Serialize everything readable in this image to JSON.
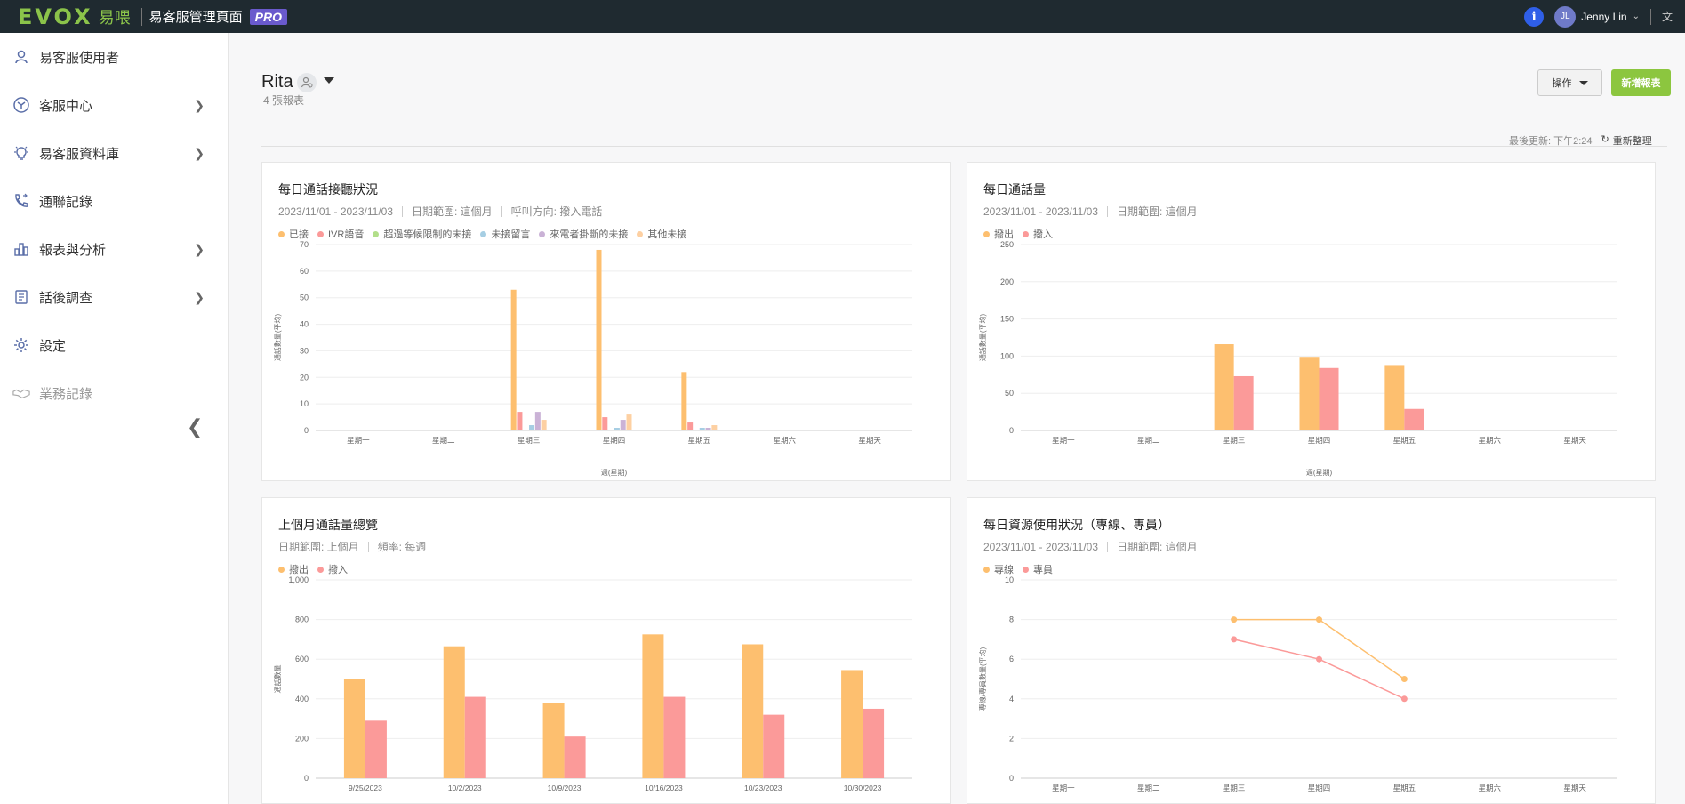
{
  "topbar": {
    "logo_main": "EVOX",
    "logo_sub": "易喂",
    "title": "易客服管理頁面",
    "pro_badge": "PRO",
    "info_icon": "info-icon",
    "user_initials": "JL",
    "user_name": "Jenny Lin",
    "lang_glyph": "文"
  },
  "sidebar": {
    "items": [
      {
        "label": "易客服使用者",
        "icon": "user-icon",
        "arrow": false
      },
      {
        "label": "客服中心",
        "icon": "hub-icon",
        "arrow": true
      },
      {
        "label": "易客服資料庫",
        "icon": "lightbulb-icon",
        "arrow": true
      },
      {
        "label": "通聯記錄",
        "icon": "phone-log-icon",
        "arrow": false
      },
      {
        "label": "報表與分析",
        "icon": "bar-chart-icon",
        "arrow": true
      },
      {
        "label": "話後調查",
        "icon": "survey-icon",
        "arrow": true
      },
      {
        "label": "設定",
        "icon": "gear-icon",
        "arrow": false
      },
      {
        "label": "業務記錄",
        "icon": "handshake-icon",
        "arrow": false,
        "disabled": true
      }
    ]
  },
  "header": {
    "title": "Rita",
    "subtitle": "4 張報表",
    "op_button": "操作",
    "new_button": "新增報表",
    "last_update": "最後更新: 下午2:24",
    "refresh_label": "重新整理"
  },
  "colors": {
    "orange": "#fdbf6f",
    "pink": "#fb9a99",
    "green": "#b2df8a",
    "blue": "#a6cee3",
    "purple": "#cab2d6",
    "peach": "#fdd0a2"
  },
  "cards": [
    {
      "title": "每日通話接聽狀況",
      "meta": [
        "2023/11/01 - 2023/11/03",
        "日期範圍: 這個月",
        "呼叫方向: 撥入電話"
      ],
      "legend": [
        {
          "name": "已接",
          "color": "#fdbf6f"
        },
        {
          "name": "IVR語音",
          "color": "#fb9a99"
        },
        {
          "name": "超過等候限制的未接",
          "color": "#b2df8a"
        },
        {
          "name": "未接留言",
          "color": "#a6cee3"
        },
        {
          "name": "來電者掛斷的未接",
          "color": "#cab2d6"
        },
        {
          "name": "其他未接",
          "color": "#fdd0a2"
        }
      ]
    },
    {
      "title": "每日通話量",
      "meta": [
        "2023/11/01 - 2023/11/03",
        "日期範圍: 這個月"
      ],
      "legend": [
        {
          "name": "撥出",
          "color": "#fdbf6f"
        },
        {
          "name": "撥入",
          "color": "#fb9a99"
        }
      ]
    },
    {
      "title": "上個月通話量總覽",
      "meta": [
        "日期範圍: 上個月",
        "頻率: 每週"
      ],
      "legend": [
        {
          "name": "撥出",
          "color": "#fdbf6f"
        },
        {
          "name": "撥入",
          "color": "#fb9a99"
        }
      ]
    },
    {
      "title": "每日資源使用狀況（專線、專員）",
      "meta": [
        "2023/11/01 - 2023/11/03",
        "日期範圍: 這個月"
      ],
      "legend": [
        {
          "name": "專線",
          "color": "#fdbf6f"
        },
        {
          "name": "專員",
          "color": "#fb9a99"
        }
      ]
    }
  ],
  "chart_data": [
    {
      "type": "bar",
      "title": "每日通話接聽狀況",
      "xlabel": "週(星期)",
      "ylabel": "通話數量(平均)",
      "ylim": [
        0,
        70
      ],
      "yticks": [
        0,
        10,
        20,
        30,
        40,
        50,
        60,
        70
      ],
      "categories": [
        "星期一",
        "星期二",
        "星期三",
        "星期四",
        "星期五",
        "星期六",
        "星期天"
      ],
      "series": [
        {
          "name": "已接",
          "color": "#fdbf6f",
          "values": [
            0,
            0,
            53,
            68,
            22,
            0,
            0
          ]
        },
        {
          "name": "IVR語音",
          "color": "#fb9a99",
          "values": [
            0,
            0,
            7,
            5,
            3,
            0,
            0
          ]
        },
        {
          "name": "超過等候限制的未接",
          "color": "#b2df8a",
          "values": [
            0,
            0,
            0,
            0,
            0,
            0,
            0
          ]
        },
        {
          "name": "未接留言",
          "color": "#a6cee3",
          "values": [
            0,
            0,
            2,
            1,
            1,
            0,
            0
          ]
        },
        {
          "name": "來電者掛斷的未接",
          "color": "#cab2d6",
          "values": [
            0,
            0,
            7,
            4,
            1,
            0,
            0
          ]
        },
        {
          "name": "其他未接",
          "color": "#fdd0a2",
          "values": [
            0,
            0,
            4,
            6,
            2,
            0,
            0
          ]
        }
      ]
    },
    {
      "type": "bar",
      "title": "每日通話量",
      "xlabel": "週(星期)",
      "ylabel": "通話數量(平均)",
      "ylim": [
        0,
        250
      ],
      "yticks": [
        0,
        50,
        100,
        150,
        200,
        250
      ],
      "categories": [
        "星期一",
        "星期二",
        "星期三",
        "星期四",
        "星期五",
        "星期六",
        "星期天"
      ],
      "series": [
        {
          "name": "撥出",
          "color": "#fdbf6f",
          "values": [
            0,
            0,
            116,
            99,
            88,
            0,
            0
          ]
        },
        {
          "name": "撥入",
          "color": "#fb9a99",
          "values": [
            0,
            0,
            73,
            84,
            29,
            0,
            0
          ]
        }
      ]
    },
    {
      "type": "bar",
      "title": "上個月通話量總覽",
      "xlabel": "",
      "ylabel": "通話數量",
      "ylim": [
        0,
        1000
      ],
      "yticks": [
        0,
        200,
        400,
        600,
        800,
        1000
      ],
      "ytick_labels": [
        "0",
        "200",
        "400",
        "600",
        "800",
        "1,000"
      ],
      "categories": [
        "9/25/2023",
        "10/2/2023",
        "10/9/2023",
        "10/16/2023",
        "10/23/2023",
        "10/30/2023"
      ],
      "series": [
        {
          "name": "撥出",
          "color": "#fdbf6f",
          "values": [
            500,
            665,
            380,
            725,
            675,
            545
          ]
        },
        {
          "name": "撥入",
          "color": "#fb9a99",
          "values": [
            290,
            410,
            210,
            410,
            320,
            350
          ]
        }
      ]
    },
    {
      "type": "line",
      "title": "每日資源使用狀況（專線、專員）",
      "xlabel": "",
      "ylabel": "專線/專員數量(平均)",
      "ylim": [
        0,
        10
      ],
      "yticks": [
        0,
        2,
        4,
        6,
        8,
        10
      ],
      "categories": [
        "星期一",
        "星期二",
        "星期三",
        "星期四",
        "星期五",
        "星期六",
        "星期天"
      ],
      "series": [
        {
          "name": "專線",
          "color": "#fdbf6f",
          "values": [
            null,
            null,
            8,
            8,
            5,
            null,
            null
          ]
        },
        {
          "name": "專員",
          "color": "#fb9a99",
          "values": [
            null,
            null,
            7,
            6,
            4,
            null,
            null
          ]
        }
      ]
    }
  ]
}
